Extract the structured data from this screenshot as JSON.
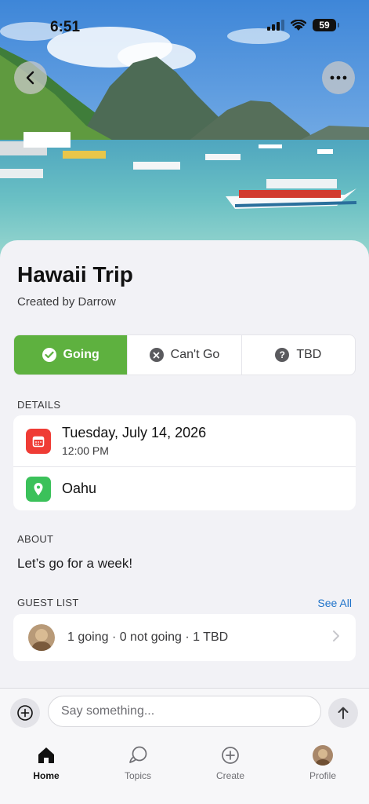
{
  "status_bar": {
    "time": "6:51",
    "battery": "59"
  },
  "header": {
    "back_icon": "chevron-left-icon",
    "more_icon": "ellipsis-icon"
  },
  "event": {
    "title": "Hawaii Trip",
    "created_by": "Created by Darrow"
  },
  "rsvp": {
    "going": "Going",
    "cant_go": "Can't Go",
    "tbd": "TBD",
    "selected": "going",
    "accent": "#5eb13f"
  },
  "details": {
    "label": "DETAILS",
    "date": "Tuesday, July 14, 2026",
    "time": "12:00 PM",
    "location": "Oahu"
  },
  "about": {
    "label": "ABOUT",
    "text": "Let’s go for a week!"
  },
  "guest_list": {
    "label": "GUEST LIST",
    "see_all": "See All",
    "summary": "1 going · 0 not going · 1 TBD"
  },
  "composer": {
    "placeholder": "Say something..."
  },
  "tabs": [
    {
      "label": "Home",
      "icon": "home-icon",
      "active": true
    },
    {
      "label": "Topics",
      "icon": "chat-bubbles-icon",
      "active": false
    },
    {
      "label": "Create",
      "icon": "plus-circle-icon",
      "active": false
    },
    {
      "label": "Profile",
      "icon": "avatar",
      "active": false
    }
  ]
}
